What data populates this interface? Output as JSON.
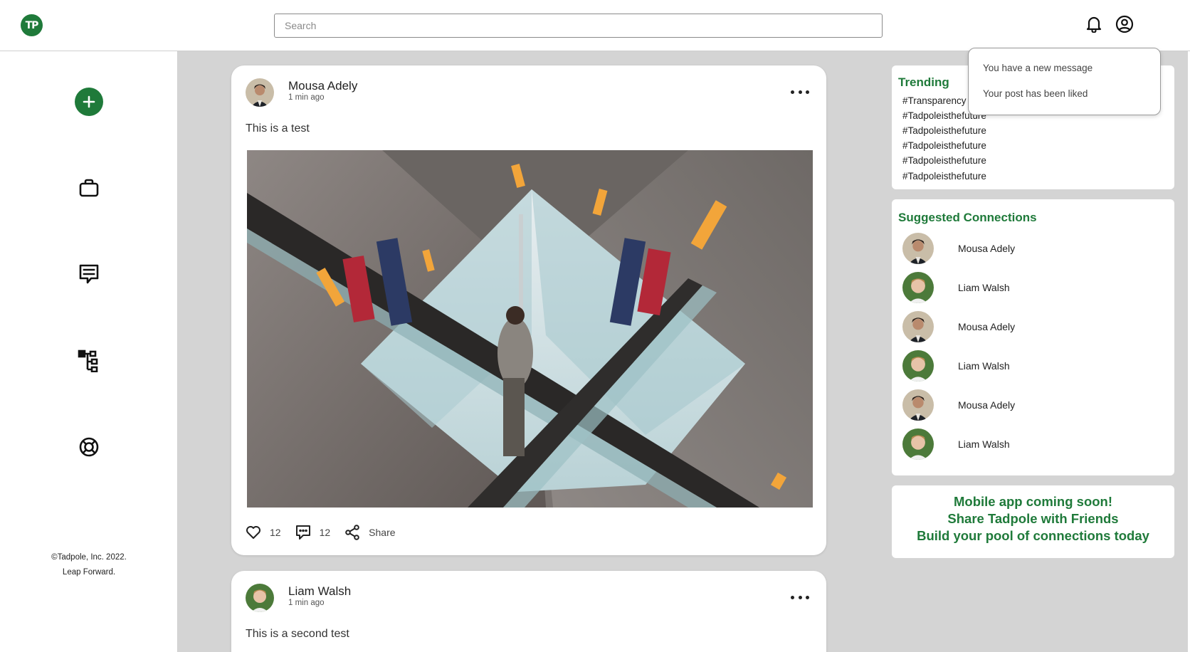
{
  "brand": {
    "logo_text": "TP",
    "accent": "#1f7a3a"
  },
  "header": {
    "search_placeholder": "Search",
    "icons": [
      "bell-icon",
      "account-circle-icon"
    ]
  },
  "sidebar": {
    "items": [
      {
        "name": "create-post",
        "icon": "plus-icon"
      },
      {
        "name": "jobs",
        "icon": "briefcase-icon"
      },
      {
        "name": "messages",
        "icon": "chat-icon"
      },
      {
        "name": "network",
        "icon": "hierarchy-icon"
      },
      {
        "name": "help",
        "icon": "lifebuoy-icon"
      }
    ],
    "footer_copyright": "©Tadpole, Inc. 2022.",
    "footer_tagline": "Leap Forward."
  },
  "posts": [
    {
      "author": "Mousa Adely",
      "time": "1 min ago",
      "text": "This is a test",
      "likes": "12",
      "comments": "12",
      "share_label": "Share"
    },
    {
      "author": "Liam Walsh",
      "time": "1 min ago",
      "text": "This is a second test"
    }
  ],
  "trending": {
    "title": "Trending",
    "tags": [
      "#Transparency",
      "#Tadpoleisthefuture",
      "#Tadpoleisthefuture",
      "#Tadpoleisthefuture",
      "#Tadpoleisthefuture",
      "#Tadpoleisthefuture"
    ]
  },
  "suggested": {
    "title": "Suggested Connections",
    "people": [
      {
        "name": "Mousa Adely"
      },
      {
        "name": "Liam Walsh"
      },
      {
        "name": "Mousa Adely"
      },
      {
        "name": "Liam Walsh"
      },
      {
        "name": "Mousa Adely"
      },
      {
        "name": "Liam Walsh"
      }
    ]
  },
  "promo": {
    "line1": "Mobile app coming soon!",
    "line2": "Share Tadpole with Friends",
    "line3": "Build your pool of connections today"
  },
  "notifications": {
    "items": [
      "You have a new message",
      "Your post has been liked"
    ]
  }
}
